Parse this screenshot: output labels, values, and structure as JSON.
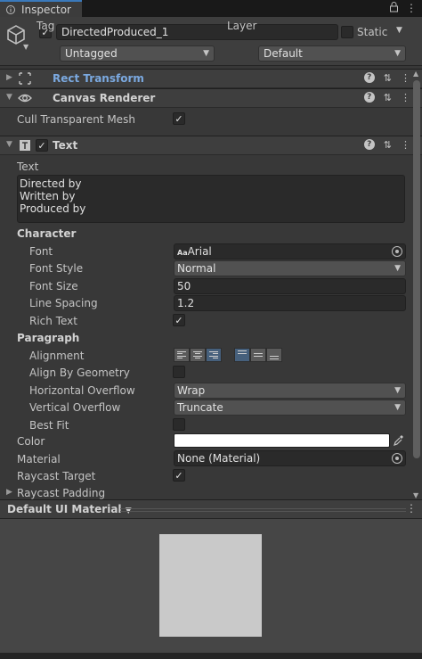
{
  "tab": {
    "title": "Inspector",
    "lock_icon": "lock-icon",
    "menu_icon": "kebab-icon"
  },
  "gameobject": {
    "active": true,
    "name": "DirectedProduced_1",
    "static_label": "Static",
    "static_checked": false,
    "tag_label": "Tag",
    "tag_value": "Untagged",
    "layer_label": "Layer",
    "layer_value": "Default"
  },
  "components": {
    "rect_transform": {
      "title": "Rect Transform",
      "expanded": false,
      "accent": "#7ba9e0"
    },
    "canvas_renderer": {
      "title": "Canvas Renderer",
      "cull_label": "Cull Transparent Mesh",
      "cull_checked": true
    },
    "text": {
      "title": "Text",
      "enabled": true,
      "text_label": "Text",
      "text_value": "Directed by\nWritten by\nProduced by",
      "character_header": "Character",
      "font_label": "Font",
      "font_value": "Arial",
      "font_icon_text": "Aa",
      "font_style_label": "Font Style",
      "font_style_value": "Normal",
      "font_size_label": "Font Size",
      "font_size_value": "50",
      "line_spacing_label": "Line Spacing",
      "line_spacing_value": "1.2",
      "rich_text_label": "Rich Text",
      "rich_text_checked": true,
      "paragraph_header": "Paragraph",
      "alignment_label": "Alignment",
      "horizontal_alignment_selected": "right",
      "vertical_alignment_selected": "top",
      "align_geometry_label": "Align By Geometry",
      "align_geometry_checked": false,
      "h_overflow_label": "Horizontal Overflow",
      "h_overflow_value": "Wrap",
      "v_overflow_label": "Vertical Overflow",
      "v_overflow_value": "Truncate",
      "best_fit_label": "Best Fit",
      "best_fit_checked": false,
      "color_label": "Color",
      "color_value": "#ffffff",
      "material_label": "Material",
      "material_value": "None (Material)",
      "raycast_target_label": "Raycast Target",
      "raycast_target_checked": true,
      "raycast_padding_label": "Raycast Padding"
    }
  },
  "material_preview": {
    "title": "Default UI Material",
    "swatch_color": "#c9c9c9"
  },
  "check_glyph": "✓"
}
